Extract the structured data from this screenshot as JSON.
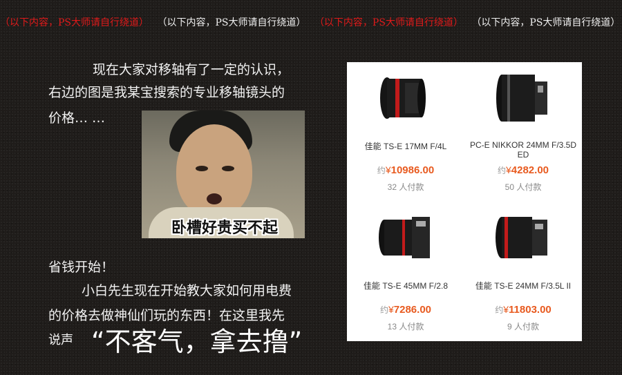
{
  "banner": {
    "items": [
      {
        "text": "（以下内容，PS大师请自行绕道）",
        "color": "#e01a1a"
      },
      {
        "text": "（以下内容，PS大师请自行绕道）",
        "color": "#f0f0f0"
      },
      {
        "text": "（以下内容，PS大师请自行绕道）",
        "color": "#e01a1a"
      },
      {
        "text": "（以下内容，PS大师请自行绕道）",
        "color": "#f0f0f0"
      }
    ]
  },
  "intro": {
    "line1": "现在大家对移轴有了一定的认识，",
    "line2": "右边的图是我某宝搜索的专业移轴镜头的",
    "line3": "价格… …"
  },
  "meme": {
    "caption": "卧槽好贵买不起"
  },
  "outro": {
    "line1": "省钱开始！",
    "line2": "小白先生现在开始教大家如何用电费",
    "line3": "的价格去做神仙们玩的东西！在这里我先",
    "line4": "说声",
    "quote": "“不客气，拿去撸”"
  },
  "products": [
    {
      "name": "佳能 TS-E 17MM F/4L",
      "prefix": "约",
      "currency": "¥",
      "price": "10986.00",
      "sold": "32 人付款",
      "icon": "tilt-shift-lens-icon"
    },
    {
      "name": "PC-E NIKKOR 24MM F/3.5D ED",
      "prefix": "约",
      "currency": "¥",
      "price": "4282.00",
      "sold": "50 人付款",
      "icon": "tilt-shift-lens-icon"
    },
    {
      "name": "佳能 TS-E 45MM F/2.8",
      "prefix": "约",
      "currency": "¥",
      "price": "7286.00",
      "sold": "13 人付款",
      "icon": "tilt-shift-lens-icon"
    },
    {
      "name": "佳能 TS-E 24MM F/3.5L II",
      "prefix": "约",
      "currency": "¥",
      "price": "11803.00",
      "sold": "9 人付款",
      "icon": "tilt-shift-lens-icon"
    }
  ],
  "colors": {
    "accent": "#e85a1f",
    "banner_red": "#e01a1a",
    "background": "#1f1c1a"
  }
}
